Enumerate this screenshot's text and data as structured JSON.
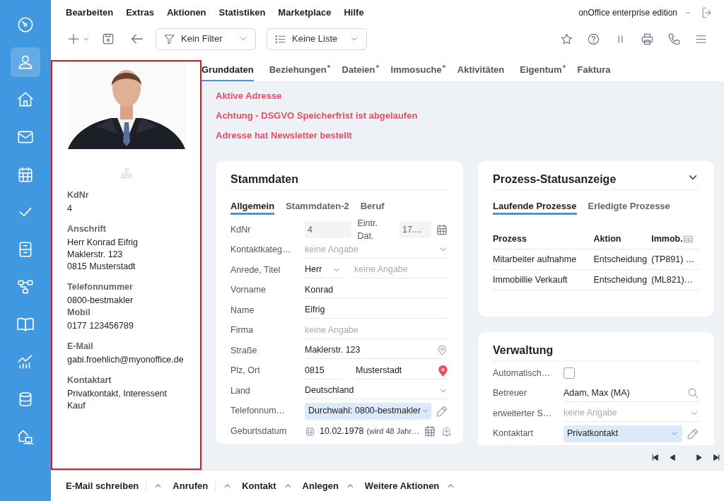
{
  "sidebar": {
    "items": [
      {
        "selected": false
      },
      {
        "selected": true
      },
      {
        "selected": false
      },
      {
        "selected": false
      },
      {
        "selected": false
      },
      {
        "selected": false
      },
      {
        "selected": false
      },
      {
        "selected": false
      },
      {
        "selected": false
      },
      {
        "selected": false
      },
      {
        "selected": false
      },
      {
        "selected": false
      }
    ]
  },
  "menu": {
    "items": [
      "Bearbeiten",
      "Extras",
      "Aktionen",
      "Statistiken",
      "Marketplace",
      "Hilfe"
    ],
    "edition": "onOffice enterprise edition"
  },
  "toolbar": {
    "filter": "Kein Filter",
    "list": "Keine Liste"
  },
  "profile": {
    "sections": [
      {
        "entries": [
          {
            "label": "KdNr",
            "lines": [
              "4"
            ]
          }
        ]
      },
      {
        "entries": [
          {
            "label": "Anschrift",
            "lines": [
              "Herr Konrad Eifrig",
              "Maklerstr. 123",
              "0815 Musterstadt"
            ]
          }
        ]
      },
      {
        "entries": [
          {
            "label": "Telefonnummer",
            "lines": [
              "0800-bestmakler"
            ]
          },
          {
            "label": "Mobil",
            "lines": [
              "0177 123456789"
            ]
          }
        ]
      },
      {
        "entries": [
          {
            "label": "E-Mail",
            "lines": [
              "gabi.froehlich@myonoffice.de"
            ]
          }
        ]
      },
      {
        "entries": [
          {
            "label": "Kontaktart",
            "lines": [
              "Privatkontakt, Interessent",
              "Kauf"
            ]
          }
        ]
      }
    ]
  },
  "tabs": [
    {
      "label": "Grunddaten",
      "selected": true,
      "dot": false
    },
    {
      "label": "Beziehungen",
      "selected": false,
      "dot": true
    },
    {
      "label": "Dateien",
      "selected": false,
      "dot": true
    },
    {
      "label": "Immosuche",
      "selected": false,
      "dot": true
    },
    {
      "label": "Aktivitäten",
      "selected": false,
      "dot": false
    },
    {
      "label": "Eigentum",
      "selected": false,
      "dot": true
    },
    {
      "label": "Faktura",
      "selected": false,
      "dot": false
    }
  ],
  "alerts": [
    "Aktive Adresse",
    "Achtung - DSGVO Speicherfrist ist abgelaufen",
    "Adresse hat Newsletter bestellt"
  ],
  "stammdaten": {
    "title": "Stammdaten",
    "tabs": [
      {
        "label": "Allgemein",
        "selected": true
      },
      {
        "label": "Stammdaten-2",
        "selected": false
      },
      {
        "label": "Beruf",
        "selected": false
      }
    ],
    "rows": [
      {
        "label": "KdNr",
        "kind": "readonly",
        "value": "4",
        "label_2": "Eintr. Dat.",
        "value_2": "17...."
      },
      {
        "label": "Kontaktkateg…",
        "kind": "select",
        "placeholder": "keine Angabe"
      },
      {
        "label": "Anrede, Titel",
        "kind": "select-text",
        "value": "Herr",
        "placeholder_2": "keine Angabe"
      },
      {
        "label": "Vorname",
        "kind": "text",
        "value": "Konrad"
      },
      {
        "label": "Name",
        "kind": "text",
        "value": "Eifrig"
      },
      {
        "label": "Firma",
        "kind": "text",
        "placeholder": "keine Angabe"
      },
      {
        "label": "Straße",
        "kind": "street",
        "value": "Maklerstr. 123"
      },
      {
        "label": "Plz, Ort",
        "kind": "zip-city",
        "value": "0815",
        "value_2": "Musterstadt"
      },
      {
        "label": "Land",
        "kind": "select",
        "value": "Deutschland"
      },
      {
        "label": "Telefonnum…",
        "kind": "highlight-select",
        "value": "Durchwahl: 0800-bestmakler"
      },
      {
        "label": "Geburtsdatum",
        "kind": "date",
        "value": "10.02.1978",
        "note": "(wird 48 Jahr…"
      }
    ]
  },
  "prozess": {
    "title": "Prozess-Statusanzeige",
    "tabs": [
      {
        "label": "Laufende Prozesse",
        "selected": true
      },
      {
        "label": "Erledigte Prozesse",
        "selected": false
      }
    ],
    "columns": [
      "Prozess",
      "Aktion",
      "Immob."
    ],
    "rows": [
      [
        "Mitarbeiter aufnahme",
        "Entscheidung",
        "(TP891) …"
      ],
      [
        "Immobillie Verkauft",
        "Entscheidung",
        "(ML821)…"
      ]
    ]
  },
  "verwaltung": {
    "title": "Verwaltung",
    "rows": [
      {
        "label": "Automatisch…",
        "kind": "checkbox",
        "checked": false
      },
      {
        "label": "Betreuer",
        "kind": "search",
        "value": "Adam, Max (MA)"
      },
      {
        "label": "erweiterter S…",
        "kind": "select",
        "placeholder": "keine Angabe"
      },
      {
        "label": "Kontaktart",
        "kind": "highlight-select",
        "value": "Privatkontakt"
      }
    ]
  },
  "actions": [
    {
      "label": "E-Mail schreiben",
      "split": true
    },
    {
      "label": "Anrufen",
      "split": true
    },
    {
      "label": "Kontakt",
      "split": false
    },
    {
      "label": "Anlegen",
      "split": false
    },
    {
      "label": "Weitere Aktionen",
      "split": false
    }
  ]
}
